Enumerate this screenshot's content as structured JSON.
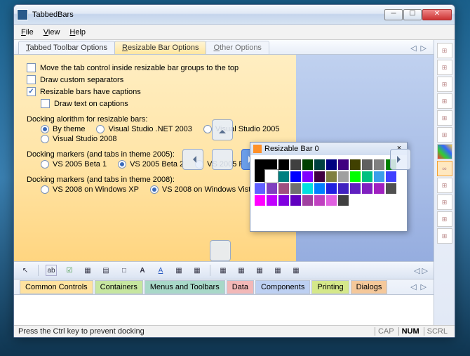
{
  "title": "TabbedBars",
  "menubar": [
    "File",
    "View",
    "Help"
  ],
  "tabs1": [
    {
      "label": "Tabbed Toolbar Options",
      "hotkey": "T"
    },
    {
      "label": "Resizable Bar Options",
      "hotkey": "R",
      "active": true
    },
    {
      "label": "Other Options",
      "hotkey": "O"
    }
  ],
  "options": {
    "move_top": "Move the tab control inside resizable bar groups to the top",
    "draw_sep": "Draw custom separators",
    "captions": "Resizable bars have captions",
    "captions_checked": true,
    "draw_text": "Draw text on captions",
    "dock_algo_label": "Docking alorithm for resizable bars:",
    "dock_algo": [
      {
        "label": "By theme",
        "on": true
      },
      {
        "label": "Visual Studio .NET 2003"
      },
      {
        "label": "Visual Studio 2005"
      },
      {
        "label": "Visual Studio 2008"
      }
    ],
    "dm2005_label": "Docking markers (and tabs in theme 2005):",
    "dm2005": [
      {
        "label": "VS 2005 Beta 1"
      },
      {
        "label": "VS 2005 Beta 2",
        "on": true
      },
      {
        "label": "VS 2005 RC"
      }
    ],
    "dm2008_label": "Docking markers (and tabs in theme 2008):",
    "dm2008": [
      {
        "label": "VS 2008 on Windows XP"
      },
      {
        "label": "VS 2008 on Windows Vista",
        "on": true
      }
    ]
  },
  "palette": {
    "title": "Resizable Bar 0"
  },
  "toolbar2": [
    "▲",
    "ab",
    "☑",
    "⊞",
    "⊟",
    "⬚",
    "A",
    "A",
    "▦",
    "▤",
    "▦",
    "▦",
    "▦",
    "▦",
    "▦"
  ],
  "tabs2": [
    "Common Controls",
    "Containers",
    "Menus and Toolbars",
    "Data",
    "Components",
    "Printing",
    "Dialogs"
  ],
  "status": {
    "left": "Press the Ctrl key to prevent docking",
    "cap": "CAP",
    "num": "NUM",
    "scrl": "SCRL"
  },
  "colors": [
    "#000000",
    "#404040",
    "#004000",
    "#004040",
    "#000080",
    "#400080",
    "#404000",
    "#606060",
    "#808080",
    "#008000",
    "#008080",
    "#0000ff",
    "#8000ff",
    "#400040",
    "#808040",
    "#a0a0a0",
    "#00ff00",
    "#00c080",
    "#3a9eea",
    "#4040ff",
    "#6060ff",
    "#8040c0",
    "#a05080",
    "#707070",
    "#00e0e0",
    "#0080ff",
    "#2020e0",
    "#4020c0",
    "#6020c0",
    "#8020c0",
    "#a020c0",
    "#505050",
    "#ff00ff",
    "#c000ff",
    "#8000e0",
    "#6000c0",
    "#a040a0",
    "#c040c0",
    "#e060e0",
    "#404040"
  ]
}
